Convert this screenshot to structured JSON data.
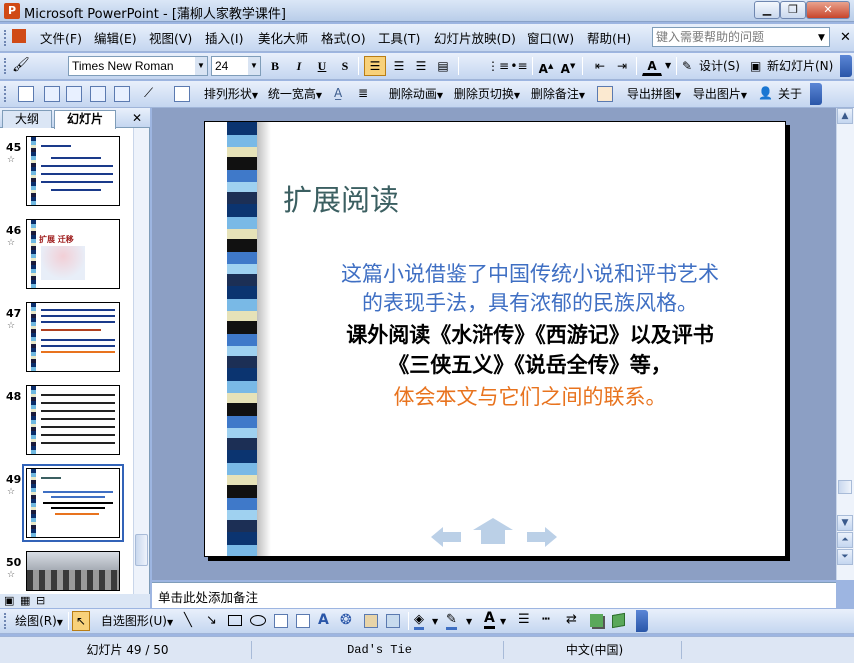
{
  "window": {
    "title": "Microsoft PowerPoint - [蒲柳人家教学课件]",
    "app_icon": "P"
  },
  "menu": {
    "items": [
      "文件(F)",
      "编辑(E)",
      "视图(V)",
      "插入(I)",
      "美化大师",
      "格式(O)",
      "工具(T)",
      "幻灯片放映(D)",
      "窗口(W)",
      "帮助(H)"
    ],
    "help_placeholder": "键入需要帮助的问题"
  },
  "format_bar": {
    "font": "Times New Roman",
    "size": "24",
    "bold": "B",
    "italic": "I",
    "underline": "U",
    "shadow": "S",
    "font_color_label": "A",
    "design_label": "设计(S)",
    "new_slide_label": "新幻灯片(N)"
  },
  "plugin_bar": {
    "arrange": "排列形状",
    "uniform_width": "统一宽高",
    "delete_anim": "删除动画",
    "delete_transition": "删除页切换",
    "delete_notes": "删除备注",
    "export_image": "导出拼图",
    "export_pictures": "导出图片",
    "about": "关于"
  },
  "left_panel": {
    "tab_outline": "大纲",
    "tab_slides": "幻灯片",
    "slides": [
      {
        "num": "45",
        "selected": false
      },
      {
        "num": "46",
        "selected": false
      },
      {
        "num": "47",
        "selected": false
      },
      {
        "num": "48",
        "selected": false
      },
      {
        "num": "49",
        "selected": true
      },
      {
        "num": "50",
        "selected": false
      }
    ],
    "thumb46_title": "扩展  迁移"
  },
  "slide": {
    "title": "扩展阅读",
    "line1": "这篇小说借鉴了中国传统小说和评书艺术",
    "line2": "的表现手法，具有浓郁的民族风格。",
    "line3": "课外阅读《水浒传》《西游记》以及评书",
    "line4": "《三侠五义》《说岳全传》等，",
    "line5": "体会本文与它们之间的联系。",
    "colors": {
      "blue": "#3f6fc3",
      "black": "#000000",
      "orange": "#e8731e",
      "title": "#3b5f61"
    }
  },
  "notes": {
    "placeholder": "单击此处添加备注"
  },
  "draw_bar": {
    "draw_label": "绘图(R)",
    "autoshape_label": "自选图形(U)"
  },
  "status": {
    "slide_pos": "幻灯片 49 / 50",
    "design": "Dad's Tie",
    "language": "中文(中国)"
  }
}
